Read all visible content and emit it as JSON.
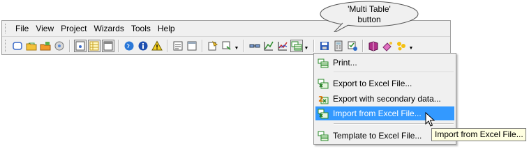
{
  "menubar": {
    "items": [
      "File",
      "View",
      "Project",
      "Wizards",
      "Tools",
      "Help"
    ]
  },
  "callout": {
    "text": "'Multi Table'\nbutton"
  },
  "toolbar": {
    "groups": [
      [
        "new-document-icon",
        "open-folder-icon",
        "open-project-icon",
        "save-disk-icon"
      ],
      [
        "chart-select-icon",
        "table-view-icon",
        "window-icon"
      ],
      [
        "globe-icon",
        "info-icon",
        "warning-icon"
      ],
      [
        "form-icon",
        "panel-icon"
      ],
      [
        "wizard-icon",
        "settings-wizard-icon"
      ],
      [
        "link-icon",
        "chart-icon",
        "line-chart-icon",
        "multi-table-icon"
      ],
      [
        "save-icon",
        "calculator-icon",
        "check-icon"
      ],
      [
        "book-icon",
        "paint-icon",
        "puzzle-icon"
      ]
    ],
    "accent": "#1e5bb8"
  },
  "dropdown": {
    "items": [
      {
        "label": "Print...",
        "icon": "print-icon"
      },
      {
        "label": "Export to Excel File...",
        "icon": "excel-export-icon"
      },
      {
        "label": "Export with secondary data...",
        "icon": "excel-export-secondary-icon"
      },
      {
        "label": "Import from Excel File...",
        "icon": "excel-import-icon",
        "highlighted": true
      },
      {
        "label": "Template to Excel File...",
        "icon": "excel-template-icon"
      }
    ],
    "highlight_color": "#3399ff"
  },
  "tooltip": {
    "text": "Import from Excel File..."
  }
}
